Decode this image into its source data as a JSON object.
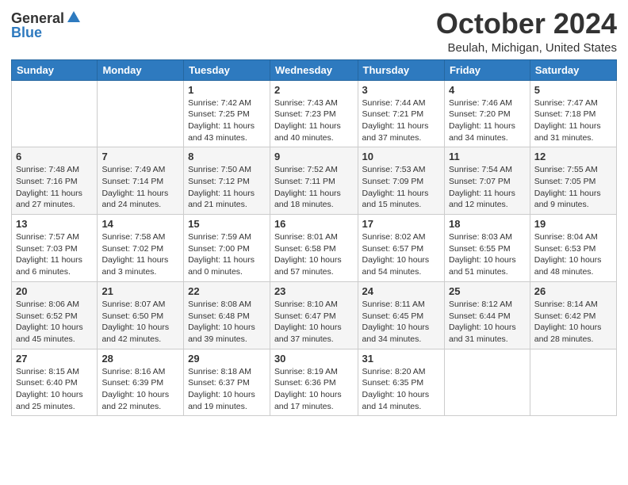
{
  "header": {
    "logo_general": "General",
    "logo_blue": "Blue",
    "month_title": "October 2024",
    "location": "Beulah, Michigan, United States"
  },
  "days_of_week": [
    "Sunday",
    "Monday",
    "Tuesday",
    "Wednesday",
    "Thursday",
    "Friday",
    "Saturday"
  ],
  "weeks": [
    [
      null,
      null,
      {
        "day": "1",
        "sunrise": "Sunrise: 7:42 AM",
        "sunset": "Sunset: 7:25 PM",
        "daylight": "Daylight: 11 hours and 43 minutes."
      },
      {
        "day": "2",
        "sunrise": "Sunrise: 7:43 AM",
        "sunset": "Sunset: 7:23 PM",
        "daylight": "Daylight: 11 hours and 40 minutes."
      },
      {
        "day": "3",
        "sunrise": "Sunrise: 7:44 AM",
        "sunset": "Sunset: 7:21 PM",
        "daylight": "Daylight: 11 hours and 37 minutes."
      },
      {
        "day": "4",
        "sunrise": "Sunrise: 7:46 AM",
        "sunset": "Sunset: 7:20 PM",
        "daylight": "Daylight: 11 hours and 34 minutes."
      },
      {
        "day": "5",
        "sunrise": "Sunrise: 7:47 AM",
        "sunset": "Sunset: 7:18 PM",
        "daylight": "Daylight: 11 hours and 31 minutes."
      }
    ],
    [
      {
        "day": "6",
        "sunrise": "Sunrise: 7:48 AM",
        "sunset": "Sunset: 7:16 PM",
        "daylight": "Daylight: 11 hours and 27 minutes."
      },
      {
        "day": "7",
        "sunrise": "Sunrise: 7:49 AM",
        "sunset": "Sunset: 7:14 PM",
        "daylight": "Daylight: 11 hours and 24 minutes."
      },
      {
        "day": "8",
        "sunrise": "Sunrise: 7:50 AM",
        "sunset": "Sunset: 7:12 PM",
        "daylight": "Daylight: 11 hours and 21 minutes."
      },
      {
        "day": "9",
        "sunrise": "Sunrise: 7:52 AM",
        "sunset": "Sunset: 7:11 PM",
        "daylight": "Daylight: 11 hours and 18 minutes."
      },
      {
        "day": "10",
        "sunrise": "Sunrise: 7:53 AM",
        "sunset": "Sunset: 7:09 PM",
        "daylight": "Daylight: 11 hours and 15 minutes."
      },
      {
        "day": "11",
        "sunrise": "Sunrise: 7:54 AM",
        "sunset": "Sunset: 7:07 PM",
        "daylight": "Daylight: 11 hours and 12 minutes."
      },
      {
        "day": "12",
        "sunrise": "Sunrise: 7:55 AM",
        "sunset": "Sunset: 7:05 PM",
        "daylight": "Daylight: 11 hours and 9 minutes."
      }
    ],
    [
      {
        "day": "13",
        "sunrise": "Sunrise: 7:57 AM",
        "sunset": "Sunset: 7:03 PM",
        "daylight": "Daylight: 11 hours and 6 minutes."
      },
      {
        "day": "14",
        "sunrise": "Sunrise: 7:58 AM",
        "sunset": "Sunset: 7:02 PM",
        "daylight": "Daylight: 11 hours and 3 minutes."
      },
      {
        "day": "15",
        "sunrise": "Sunrise: 7:59 AM",
        "sunset": "Sunset: 7:00 PM",
        "daylight": "Daylight: 11 hours and 0 minutes."
      },
      {
        "day": "16",
        "sunrise": "Sunrise: 8:01 AM",
        "sunset": "Sunset: 6:58 PM",
        "daylight": "Daylight: 10 hours and 57 minutes."
      },
      {
        "day": "17",
        "sunrise": "Sunrise: 8:02 AM",
        "sunset": "Sunset: 6:57 PM",
        "daylight": "Daylight: 10 hours and 54 minutes."
      },
      {
        "day": "18",
        "sunrise": "Sunrise: 8:03 AM",
        "sunset": "Sunset: 6:55 PM",
        "daylight": "Daylight: 10 hours and 51 minutes."
      },
      {
        "day": "19",
        "sunrise": "Sunrise: 8:04 AM",
        "sunset": "Sunset: 6:53 PM",
        "daylight": "Daylight: 10 hours and 48 minutes."
      }
    ],
    [
      {
        "day": "20",
        "sunrise": "Sunrise: 8:06 AM",
        "sunset": "Sunset: 6:52 PM",
        "daylight": "Daylight: 10 hours and 45 minutes."
      },
      {
        "day": "21",
        "sunrise": "Sunrise: 8:07 AM",
        "sunset": "Sunset: 6:50 PM",
        "daylight": "Daylight: 10 hours and 42 minutes."
      },
      {
        "day": "22",
        "sunrise": "Sunrise: 8:08 AM",
        "sunset": "Sunset: 6:48 PM",
        "daylight": "Daylight: 10 hours and 39 minutes."
      },
      {
        "day": "23",
        "sunrise": "Sunrise: 8:10 AM",
        "sunset": "Sunset: 6:47 PM",
        "daylight": "Daylight: 10 hours and 37 minutes."
      },
      {
        "day": "24",
        "sunrise": "Sunrise: 8:11 AM",
        "sunset": "Sunset: 6:45 PM",
        "daylight": "Daylight: 10 hours and 34 minutes."
      },
      {
        "day": "25",
        "sunrise": "Sunrise: 8:12 AM",
        "sunset": "Sunset: 6:44 PM",
        "daylight": "Daylight: 10 hours and 31 minutes."
      },
      {
        "day": "26",
        "sunrise": "Sunrise: 8:14 AM",
        "sunset": "Sunset: 6:42 PM",
        "daylight": "Daylight: 10 hours and 28 minutes."
      }
    ],
    [
      {
        "day": "27",
        "sunrise": "Sunrise: 8:15 AM",
        "sunset": "Sunset: 6:40 PM",
        "daylight": "Daylight: 10 hours and 25 minutes."
      },
      {
        "day": "28",
        "sunrise": "Sunrise: 8:16 AM",
        "sunset": "Sunset: 6:39 PM",
        "daylight": "Daylight: 10 hours and 22 minutes."
      },
      {
        "day": "29",
        "sunrise": "Sunrise: 8:18 AM",
        "sunset": "Sunset: 6:37 PM",
        "daylight": "Daylight: 10 hours and 19 minutes."
      },
      {
        "day": "30",
        "sunrise": "Sunrise: 8:19 AM",
        "sunset": "Sunset: 6:36 PM",
        "daylight": "Daylight: 10 hours and 17 minutes."
      },
      {
        "day": "31",
        "sunrise": "Sunrise: 8:20 AM",
        "sunset": "Sunset: 6:35 PM",
        "daylight": "Daylight: 10 hours and 14 minutes."
      },
      null,
      null
    ]
  ]
}
